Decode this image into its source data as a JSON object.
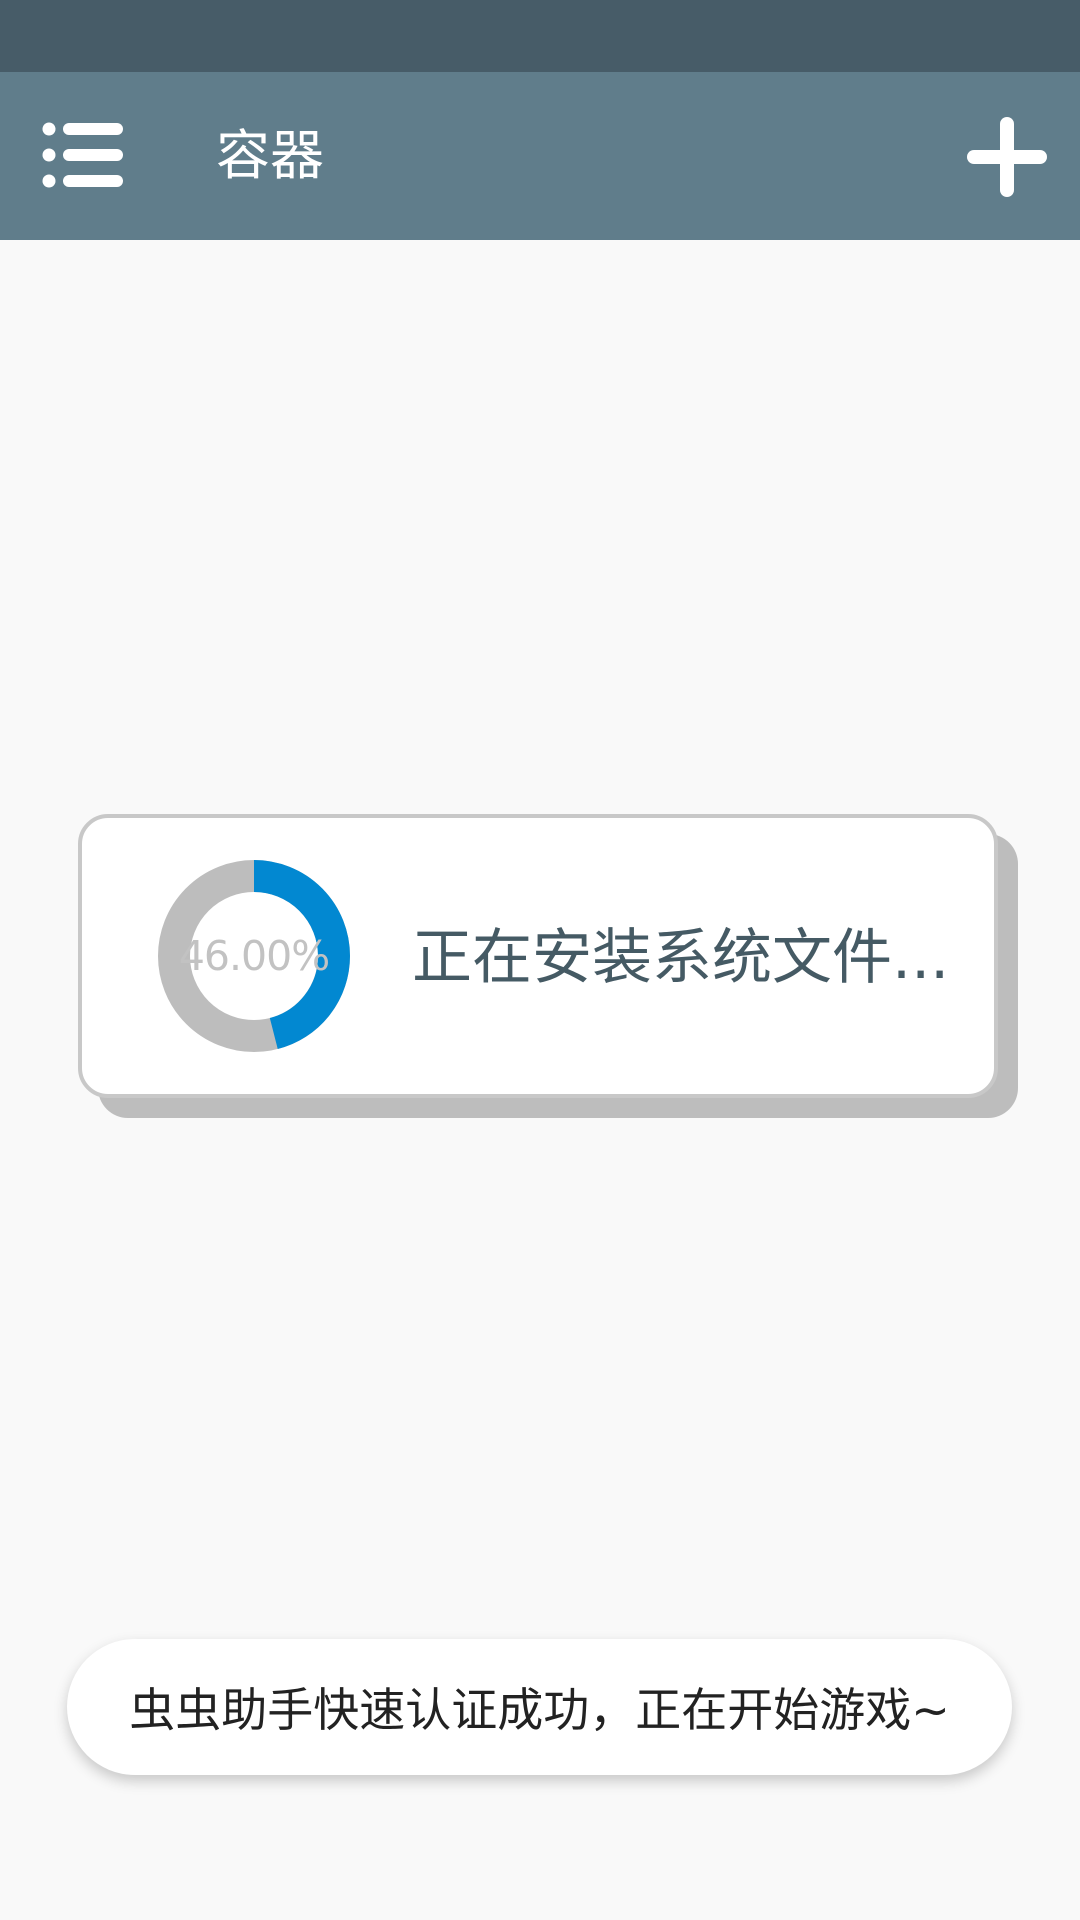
{
  "app_bar": {
    "title": "容器",
    "menu_icon": "menu-icon",
    "add_icon": "plus-icon"
  },
  "dialog": {
    "progress_percent": 46.0,
    "progress_label": "46.00%",
    "message": "正在安装系统文件..."
  },
  "toast": {
    "message": "虫虫助手快速认证成功，正在开始游戏~"
  },
  "colors": {
    "status_bar": "#475c68",
    "app_bar": "#607d8b",
    "progress_fill": "#0288d1",
    "progress_track": "#bdbdbd",
    "dialog_text": "#455a64"
  }
}
